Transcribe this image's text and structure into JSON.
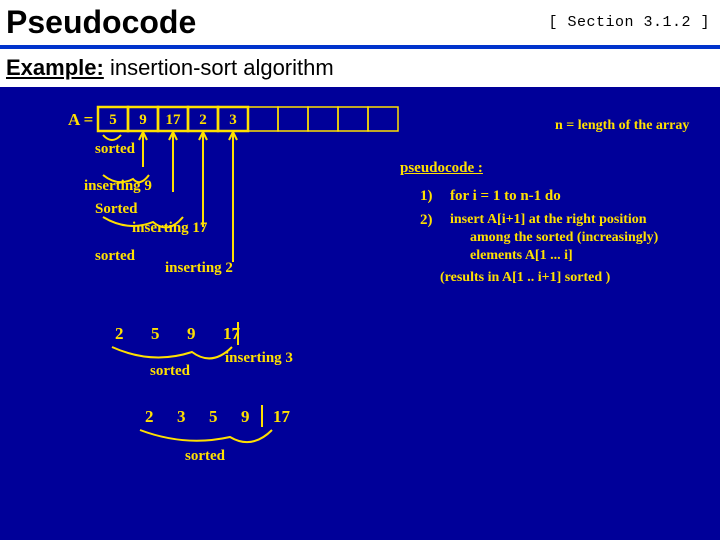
{
  "header": {
    "title": "Pseudocode",
    "section_ref": "[ Section 3.1.2 ]"
  },
  "example": {
    "label": "Example:",
    "text": " insertion-sort algorithm"
  },
  "array": {
    "label": "A =",
    "values": [
      "5",
      "9",
      "17",
      "2",
      "3",
      "",
      "",
      "",
      "",
      ""
    ]
  },
  "annotations": {
    "sorted1": "sorted",
    "inserting9": "inserting 9",
    "sorted2": "Sorted",
    "inserting17": "inserting 17",
    "sorted3": "sorted",
    "inserting2": "inserting 2",
    "row2": [
      "2",
      "5",
      "9",
      "17"
    ],
    "sorted4": "sorted",
    "inserting3": "inserting 3",
    "row3": [
      "2",
      "3",
      "5",
      "9",
      "17"
    ],
    "sorted5": "sorted",
    "n_label": "n = length of the array"
  },
  "pseudocode": {
    "heading": "pseudocode :",
    "line1_num": "1)",
    "line1": "for i = 1  to  n-1  do",
    "line2_num": "2)",
    "line2a": "insert A[i+1] at the right position",
    "line2b": "among the sorted (increasingly)",
    "line2c": "elements A[1 ... i]",
    "line3": "(results in  A[1 .. i+1] sorted )"
  }
}
